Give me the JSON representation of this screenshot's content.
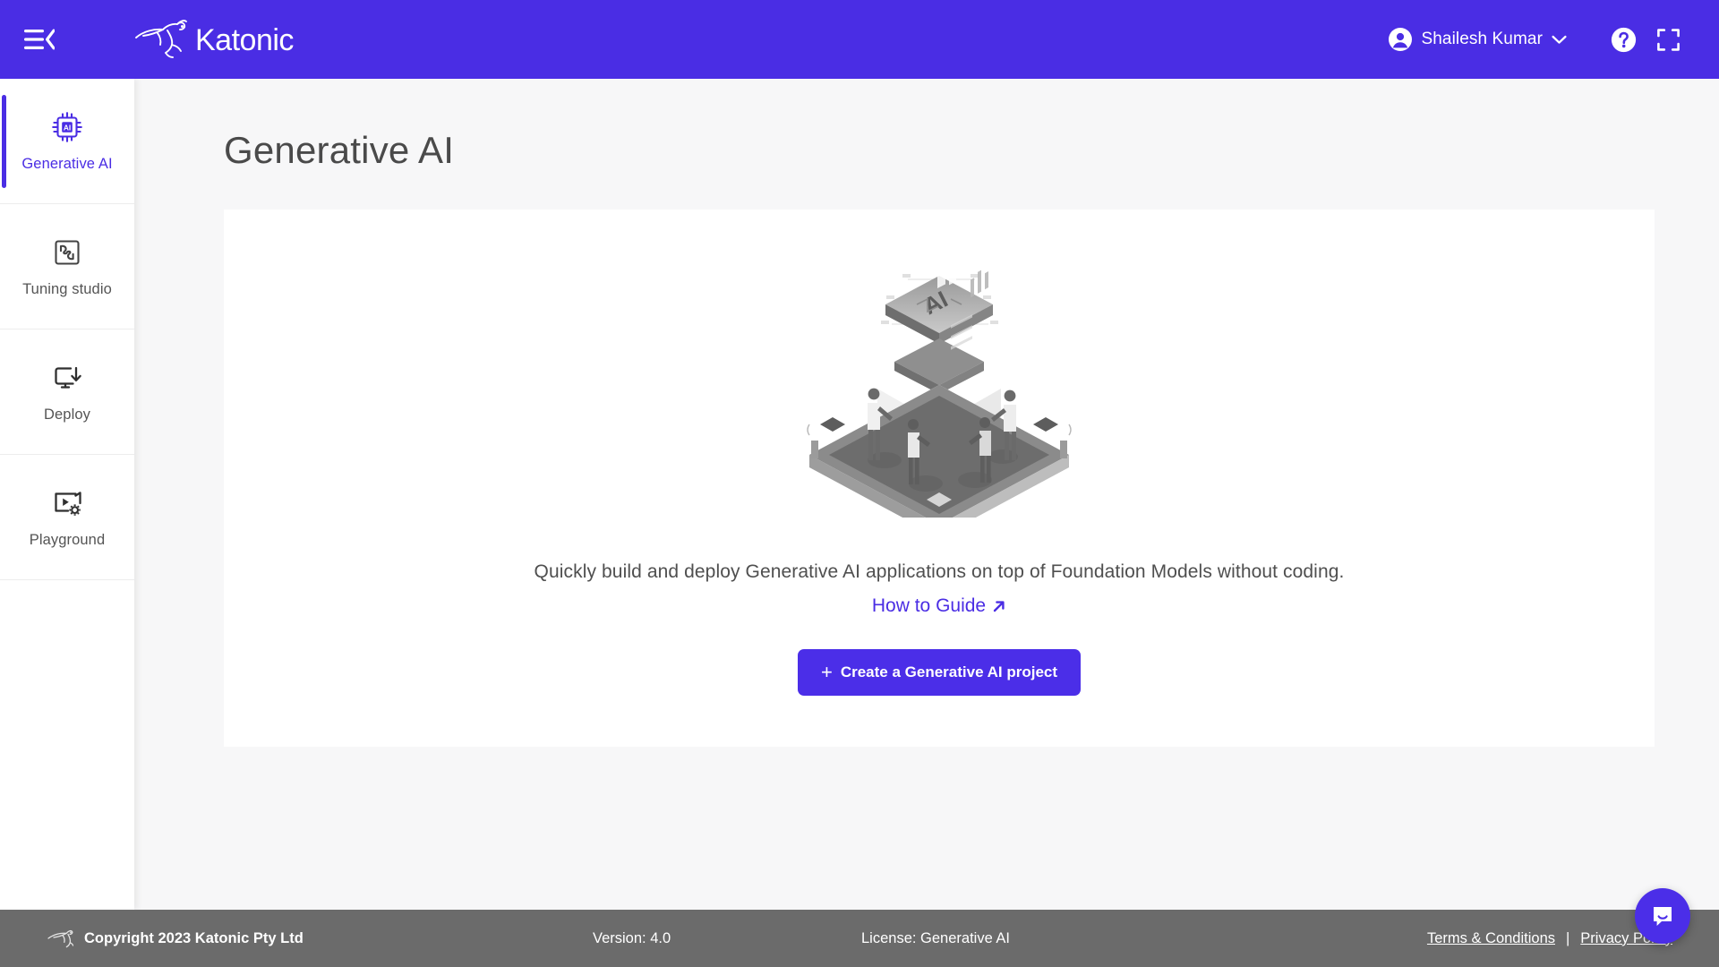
{
  "theme": {
    "header_purple": "#4a2de4",
    "button_purple": "#4b2ee8",
    "footer_gray": "#6b6b6b",
    "page_bg": "#f7f7f8",
    "card_bg": "#ffffff",
    "active_nav_text": "#4a2de4"
  },
  "header": {
    "menu_icon": "hamburger-collapse-icon",
    "brand_name": "Katonic",
    "brand_mark": "kangaroo-logo-icon",
    "user": {
      "name": "Shailesh Kumar",
      "avatar_icon": "user-avatar-icon",
      "chevron_icon": "chevron-down-icon"
    },
    "help_icon": "question-mark-circle-icon",
    "fullscreen_icon": "fullscreen-expand-icon"
  },
  "sidebar": {
    "items": [
      {
        "label": "Generative AI",
        "icon": "ai-chip-icon",
        "active": true
      },
      {
        "label": "Tuning studio",
        "icon": "puzzle-icon",
        "active": false
      },
      {
        "label": "Deploy",
        "icon": "monitor-download-icon",
        "active": false
      },
      {
        "label": "Playground",
        "icon": "video-gear-icon",
        "active": false
      }
    ]
  },
  "main": {
    "page_title": "Generative AI",
    "card": {
      "illustration": "isometric-ai-platform-illustration",
      "description": "Quickly build and deploy Generative AI applications on top of Foundation Models without coding.",
      "guide_link": "How to Guide",
      "guide_link_icon": "external-link-arrow-icon",
      "cta_plus": "+",
      "cta_label": "Create a Generative AI project"
    }
  },
  "footer": {
    "logo_icon": "kangaroo-logo-icon",
    "copyright": "Copyright 2023 Katonic Pty Ltd",
    "version": "Version: 4.0",
    "license": "License: Generative AI",
    "terms_link": "Terms & Conditions",
    "separator": "|",
    "privacy_link": "Privacy Policy"
  },
  "chat_widget": {
    "icon": "chat-bubble-smile-icon"
  }
}
